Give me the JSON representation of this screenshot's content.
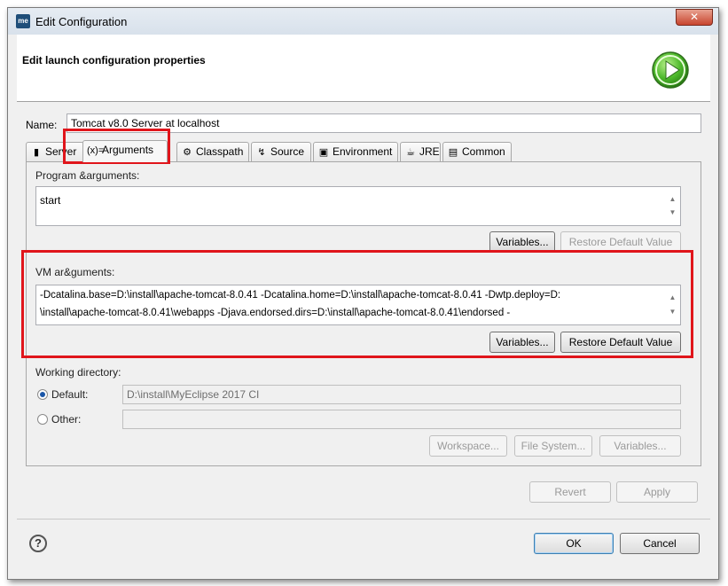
{
  "window": {
    "title": "Edit Configuration",
    "app_icon": "me",
    "close_label": "✕"
  },
  "header": {
    "title": "Edit launch configuration properties",
    "icon": "run-play-icon"
  },
  "name": {
    "label": "Name:",
    "value": "Tomcat v8.0 Server at localhost"
  },
  "tabs": [
    {
      "label": "Server",
      "icon": "server-icon"
    },
    {
      "label": "Arguments",
      "icon": "arguments-icon",
      "active": true
    },
    {
      "label": "Classpath",
      "icon": "classpath-icon"
    },
    {
      "label": "Source",
      "icon": "source-icon"
    },
    {
      "label": "Environment",
      "icon": "environment-icon"
    },
    {
      "label": "JRE",
      "icon": "jre-icon"
    },
    {
      "label": "Common",
      "icon": "common-icon"
    }
  ],
  "program_args": {
    "label": "Program &arguments:",
    "value": "start",
    "variables_label": "Variables...",
    "restore_label": "Restore Default Value"
  },
  "vm_args": {
    "label": "VM ar&guments:",
    "line1": "-Dcatalina.base=D:\\install\\apache-tomcat-8.0.41 -Dcatalina.home=D:\\install\\apache-tomcat-8.0.41 -Dwtp.deploy=D:",
    "line2": "\\install\\apache-tomcat-8.0.41\\webapps -Djava.endorsed.dirs=D:\\install\\apache-tomcat-8.0.41\\endorsed -",
    "variables_label": "Variables...",
    "restore_label": "Restore Default Value"
  },
  "working_dir": {
    "label": "Working directory:",
    "default_label": "Default:",
    "default_value": "D:\\install\\MyEclipse 2017 CI",
    "other_label": "Other:",
    "other_value": "",
    "workspace_label": "Workspace...",
    "filesystem_label": "File System...",
    "variables_label": "Variables..."
  },
  "footer": {
    "revert_label": "Revert",
    "apply_label": "Apply",
    "ok_label": "OK",
    "cancel_label": "Cancel",
    "help_label": "?"
  },
  "colors": {
    "highlight": "#e0151b",
    "accent": "#1a56a8"
  }
}
